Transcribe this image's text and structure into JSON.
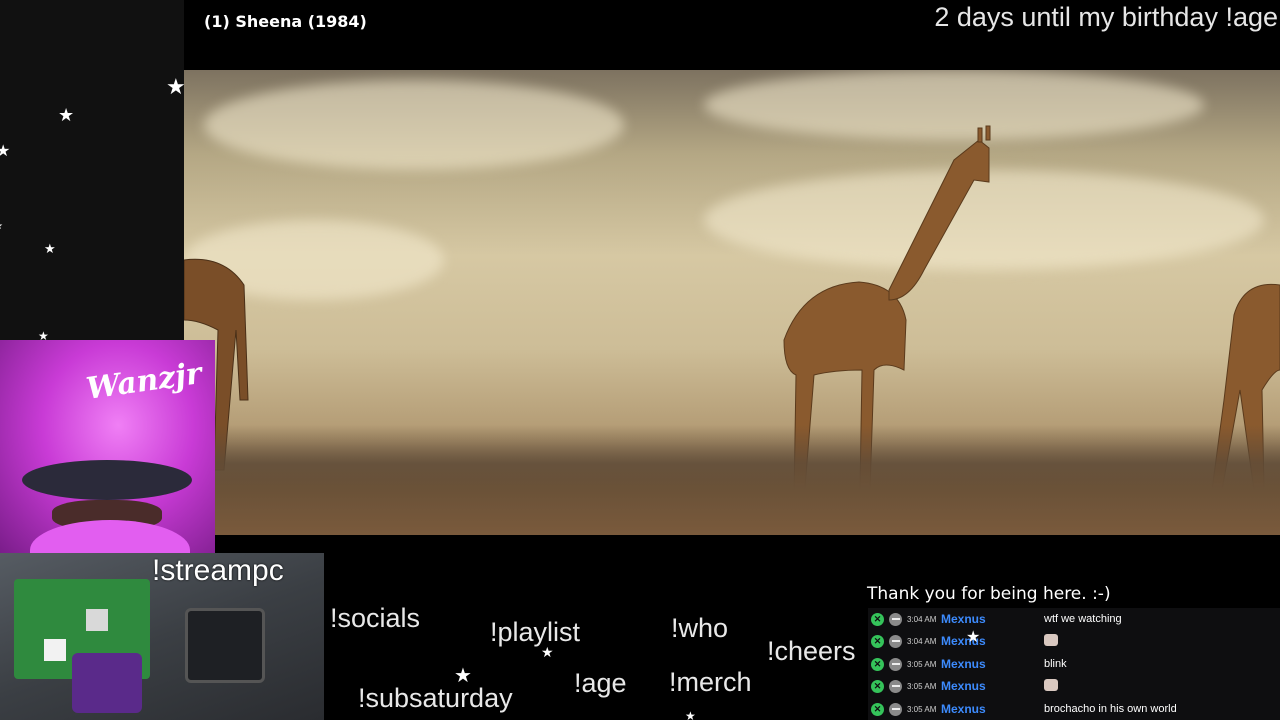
{
  "video": {
    "title": "(1) Sheena (1984)"
  },
  "marquee": {
    "text": "2 days until my birthday !age"
  },
  "avatar": {
    "brand_text": "Wanzjr"
  },
  "hardware": {
    "label": "!streampc"
  },
  "commands": [
    {
      "label": "!socials"
    },
    {
      "label": "!playlist"
    },
    {
      "label": "!who"
    },
    {
      "label": "!cheers"
    },
    {
      "label": "!subsaturday"
    },
    {
      "label": "!age"
    },
    {
      "label": "!merch"
    }
  ],
  "chat": {
    "header": "Thank you for being here. :-)",
    "messages": [
      {
        "time": "3:04 AM",
        "user": "Mexnus",
        "text": "wtf we watching",
        "emote": false
      },
      {
        "time": "3:04 AM",
        "user": "Mexnus",
        "text": "",
        "emote": true
      },
      {
        "time": "3:05 AM",
        "user": "Mexnus",
        "text": "blink",
        "emote": false
      },
      {
        "time": "3:05 AM",
        "user": "Mexnus",
        "text": "",
        "emote": true
      },
      {
        "time": "3:05 AM",
        "user": "Mexnus",
        "text": "brochacho in his own world",
        "emote": false
      }
    ],
    "user_color": "#3d8bfd",
    "mod_badge_color": "#35c35a"
  },
  "icons": {
    "star": "star-icon",
    "mod_badge": "moderator-badge-icon",
    "sub_badge": "subscriber-badge-icon"
  }
}
